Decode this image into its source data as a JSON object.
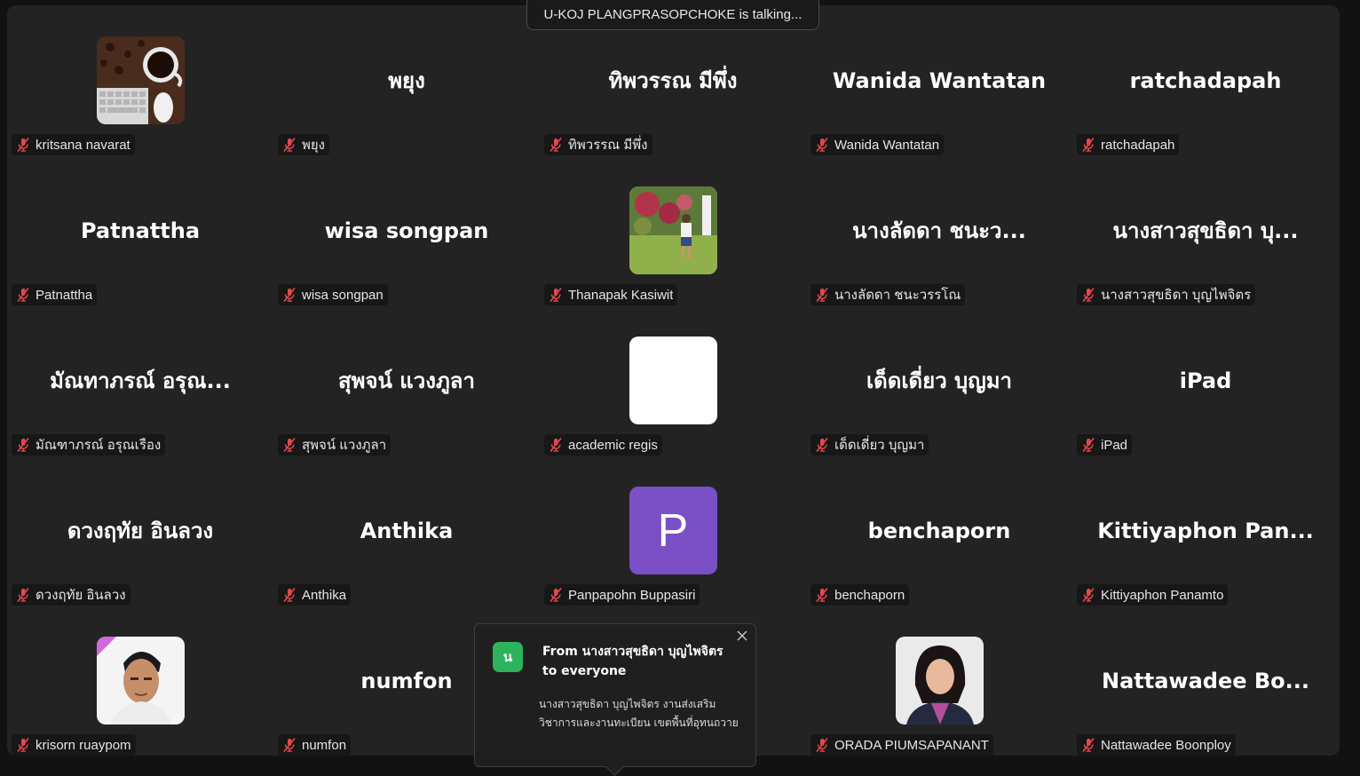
{
  "talking_indicator": "U-KOJ PLANGPRASOPCHOKE is talking...",
  "participants": [
    {
      "display": "",
      "label": "kritsana navarat",
      "avatar": "coffee-keyboard-photo"
    },
    {
      "display": "พยุง",
      "label": "พยุง"
    },
    {
      "display": "ทิพวรรณ มีพึ่ง",
      "label": "ทิพวรรณ มีพึ่ง"
    },
    {
      "display": "Wanida Wantatan",
      "label": "Wanida Wantatan"
    },
    {
      "display": "ratchadapah",
      "label": "ratchadapah"
    },
    {
      "display": "Patnattha",
      "label": "Patnattha"
    },
    {
      "display": "wisa songpan",
      "label": "wisa songpan"
    },
    {
      "display": "",
      "label": "Thanapak Kasiwit",
      "avatar": "garden-person-photo"
    },
    {
      "display": "นางลัดดา ชนะว...",
      "label": "นางลัดดา ชนะวรรโณ"
    },
    {
      "display": "นางสาวสุขธิดา บุ...",
      "label": "นางสาวสุขธิดา บุญไพจิตร"
    },
    {
      "display": "มัณทาภรณ์ อรุณ...",
      "label": "มัณฑาภรณ์ อรุณเรือง"
    },
    {
      "display": "สุพจน์ แวงภูลา",
      "label": "สุพจน์ แวงภูลา"
    },
    {
      "display": "",
      "label": "academic regis",
      "avatar": "blank-white"
    },
    {
      "display": "เด็ดเดี่ยว บุญมา",
      "label": "เด็ดเดี่ยว บุญมา"
    },
    {
      "display": "iPad",
      "label": "iPad"
    },
    {
      "display": "ดวงฤทัย อินลวง",
      "label": "ดวงฤทัย อินลวง"
    },
    {
      "display": "Anthika",
      "label": "Anthika"
    },
    {
      "display": "",
      "label": "Panpapohn Buppasiri",
      "avatar": "letter",
      "letter": "P",
      "avatar_color": "#7b4fc6"
    },
    {
      "display": "benchaporn",
      "label": "benchaporn"
    },
    {
      "display": "Kittiyaphon Pan...",
      "label": "Kittiyaphon Panamto"
    },
    {
      "display": "",
      "label": "krisorn ruaypom",
      "avatar": "man-portrait-photo"
    },
    {
      "display": "numfon",
      "label": "numfon"
    },
    {
      "display": "",
      "label": "",
      "hidden": true
    },
    {
      "display": "",
      "label": "ORADA PIUMSAPANANT",
      "avatar": "woman-portrait-photo"
    },
    {
      "display": "Nattawadee Bo...",
      "label": "Nattawadee Boonploy"
    }
  ],
  "chat_popup": {
    "avatar_letter": "น",
    "avatar_color": "#2db35c",
    "from_line": "From นางสาวสุขธิดา บุญไพจิตร",
    "to_line": "to everyone",
    "message": "นางสาวสุขธิดา บุญไพจิตร งานส่งเสริมวิชาการและงานทะเบียน เขตพื้นที่อุทนถวาย"
  },
  "colors": {
    "background": "#121212",
    "gallery": "#232323",
    "muted_mic": "#e5484d"
  },
  "icons": {
    "muted": "muted-mic-icon",
    "close": "close-icon"
  }
}
